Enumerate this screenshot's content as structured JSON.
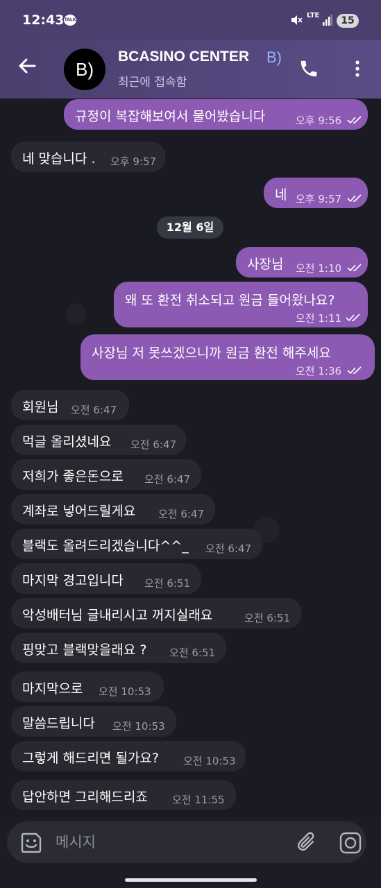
{
  "status_bar": {
    "time": "12:43",
    "talk_badge": "TALK",
    "network": "LTE",
    "battery": "15"
  },
  "header": {
    "avatar_text": "B)",
    "title": "BCASINO CENTER",
    "title_tail": "B)",
    "status": "최근에 접속함"
  },
  "date_divider": "12월 6일",
  "messages": [
    {
      "dir": "out",
      "text": "규정이 복잡해보여서 물어봤습니다",
      "time": "오후 9:56"
    },
    {
      "dir": "in",
      "text": "네 맞습니다 .",
      "time": "오후 9:57"
    },
    {
      "dir": "out",
      "text": "네",
      "time": "오후 9:57"
    },
    {
      "dir": "out",
      "text": "사장님",
      "time": "오전 1:10"
    },
    {
      "dir": "out",
      "text": "왜 또 환전 취소되고 원금 들어왔나요?",
      "time": "오전 1:11"
    },
    {
      "dir": "out",
      "text": "사장님 저 못쓰겠으니까 원금 환전 해주세요",
      "time": "오전 1:36"
    },
    {
      "dir": "in",
      "text": "회원님",
      "time": "오전 6:47"
    },
    {
      "dir": "in",
      "text": "먹글 올리셨네요",
      "time": "오전 6:47"
    },
    {
      "dir": "in",
      "text": "저희가 좋은돈으로",
      "time": "오전 6:47"
    },
    {
      "dir": "in",
      "text": "계좌로 넣어드릴게요",
      "time": "오전 6:47"
    },
    {
      "dir": "in",
      "text": "블랙도 올려드리겠습니다^^_",
      "time": "오전 6:47"
    },
    {
      "dir": "in",
      "text": "마지막 경고입니다",
      "time": "오전 6:51"
    },
    {
      "dir": "in",
      "text": "악성배터님 글내리시고 꺼지실래요",
      "time": "오전 6:51"
    },
    {
      "dir": "in",
      "text": "핑맞고 블랙맞을래요 ?",
      "time": "오전 6:51"
    },
    {
      "dir": "in",
      "text": "마지막으로",
      "time": "오전 10:53"
    },
    {
      "dir": "in",
      "text": "말씀드립니다",
      "time": "오전 10:53"
    },
    {
      "dir": "in",
      "text": "그렇게 해드리면 될가요?",
      "time": "오전 10:53"
    },
    {
      "dir": "in",
      "text": "답안하면 그리해드리죠",
      "time": "오전 11:55"
    }
  ],
  "composer": {
    "placeholder": "메시지"
  },
  "icons": {
    "back": "back-arrow-icon",
    "call": "phone-icon",
    "menu": "more-vertical-icon",
    "emoji": "sticker-icon",
    "attach": "paperclip-icon",
    "camera": "camera-icon",
    "read": "double-check-icon"
  },
  "colors": {
    "outgoing_bubble": "#8c5ab3",
    "incoming_bubble": "#272830",
    "header": "#4a3f6e"
  }
}
